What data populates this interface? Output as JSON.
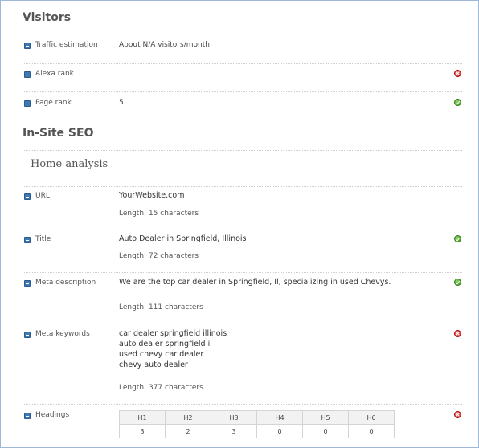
{
  "visitors": {
    "title": "Visitors",
    "rows": {
      "traffic": {
        "label": "Traffic estimation",
        "value": "About N/A visitors/month"
      },
      "alexa": {
        "label": "Alexa rank",
        "value": ""
      },
      "pagerank": {
        "label": "Page rank",
        "value": "5"
      }
    }
  },
  "insite": {
    "title": "In-Site SEO",
    "home_title": "Home analysis",
    "url": {
      "label": "URL",
      "value": "YourWebsite.com",
      "length_label": "Length:",
      "length_value": "15 characters"
    },
    "title_row": {
      "label": "Title",
      "value": "Auto Dealer in Springfield, Illinois",
      "length_label": "Length:",
      "length_value": "72 characters"
    },
    "meta_description": {
      "label": "Meta description",
      "value": "We are the top car dealer in Springfield, Il, specializing in used Chevys.",
      "length_label": "Length:",
      "length_value": "111 characters"
    },
    "meta_keywords": {
      "label": "Meta keywords",
      "lines": [
        "car dealer springfield illinois",
        "auto dealer springfield il",
        "used chevy car dealer",
        "chevy auto dealer"
      ],
      "length_label": "Length:",
      "length_value": "377 characters"
    },
    "headings": {
      "label": "Headings",
      "columns": [
        "H1",
        "H2",
        "H3",
        "H4",
        "H5",
        "H6"
      ],
      "counts": [
        "3",
        "2",
        "3",
        "0",
        "0",
        "0"
      ]
    }
  },
  "icons": {
    "expand": "plus-square-icon",
    "ok": "check-circle-icon",
    "error": "x-circle-icon"
  },
  "colors": {
    "ok": "#3c9a1e",
    "error": "#d11b1b",
    "expand": "#3f78b4"
  }
}
